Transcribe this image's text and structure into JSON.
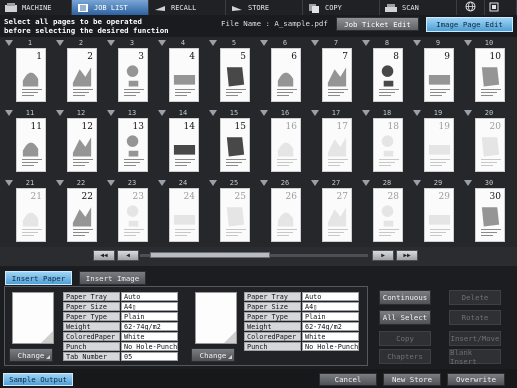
{
  "tabs": [
    {
      "label": "MACHINE",
      "icon": "machine-icon"
    },
    {
      "label": "JOB LIST",
      "icon": "job-list-icon",
      "active": true
    },
    {
      "label": "RECALL",
      "icon": "recall-icon"
    },
    {
      "label": "STORE",
      "icon": "store-icon"
    },
    {
      "label": "COPY",
      "icon": "copy-icon"
    },
    {
      "label": "SCAN",
      "icon": "scan-icon"
    }
  ],
  "header": {
    "instruction_line1": "Select all pages to be operated",
    "instruction_line2": "before selecting the desired function",
    "file_name": "File Name : A_sample.pdf",
    "job_ticket_edit": "Job Ticket Edit",
    "image_page_edit": "Image Page Edit"
  },
  "pages": [
    {
      "num": "1"
    },
    {
      "num": "2"
    },
    {
      "num": "3"
    },
    {
      "num": "4"
    },
    {
      "num": "5"
    },
    {
      "num": "6"
    },
    {
      "num": "7"
    },
    {
      "num": "8"
    },
    {
      "num": "9"
    },
    {
      "num": "10"
    },
    {
      "num": "11"
    },
    {
      "num": "12"
    },
    {
      "num": "13"
    },
    {
      "num": "14"
    },
    {
      "num": "15"
    },
    {
      "num": "16"
    },
    {
      "num": "17"
    },
    {
      "num": "18"
    },
    {
      "num": "19"
    },
    {
      "num": "20"
    },
    {
      "num": "21"
    },
    {
      "num": "22"
    },
    {
      "num": "23"
    },
    {
      "num": "24"
    },
    {
      "num": "25"
    },
    {
      "num": "26"
    },
    {
      "num": "27"
    },
    {
      "num": "28"
    },
    {
      "num": "29"
    },
    {
      "num": "30"
    }
  ],
  "scroll_buttons": {
    "first": "◀◀",
    "prev": "◀",
    "next": "▶",
    "last": "▶▶"
  },
  "lower_tabs": {
    "insert_paper": "Insert Paper",
    "insert_image": "Insert Image"
  },
  "left_paper": {
    "change": "Change",
    "rows": [
      {
        "k": "Paper Tray",
        "v": "Auto"
      },
      {
        "k": "Paper Size",
        "v": "A4▯"
      },
      {
        "k": "Paper Type",
        "v": "Plain"
      },
      {
        "k": "Weight",
        "v": "62-74g/m2"
      },
      {
        "k": "ColoredPaper",
        "v": "White"
      },
      {
        "k": "Punch",
        "v": "No Hole-Punch"
      },
      {
        "k": "Tab Number",
        "v": "05"
      }
    ]
  },
  "right_paper": {
    "change": "Change",
    "rows": [
      {
        "k": "Paper Tray",
        "v": "Auto"
      },
      {
        "k": "Paper Size",
        "v": "A4▯"
      },
      {
        "k": "Paper Type",
        "v": "Plain"
      },
      {
        "k": "Weight",
        "v": "62-74g/m2"
      },
      {
        "k": "ColoredPaper",
        "v": "White"
      },
      {
        "k": "Punch",
        "v": "No Hole-Punch"
      }
    ]
  },
  "actions": {
    "continuous": "Continuous",
    "all_select": "All Select",
    "copy": "Copy",
    "chapters": "Chapters",
    "delete": "Delete",
    "rotate": "Rotate",
    "insert_move": "Insert/Move",
    "blank_insert": "Blank Insert"
  },
  "footer": {
    "sample_output": "Sample Output",
    "cancel": "Cancel",
    "new_store": "New Store",
    "overwrite": "Overwrite"
  }
}
